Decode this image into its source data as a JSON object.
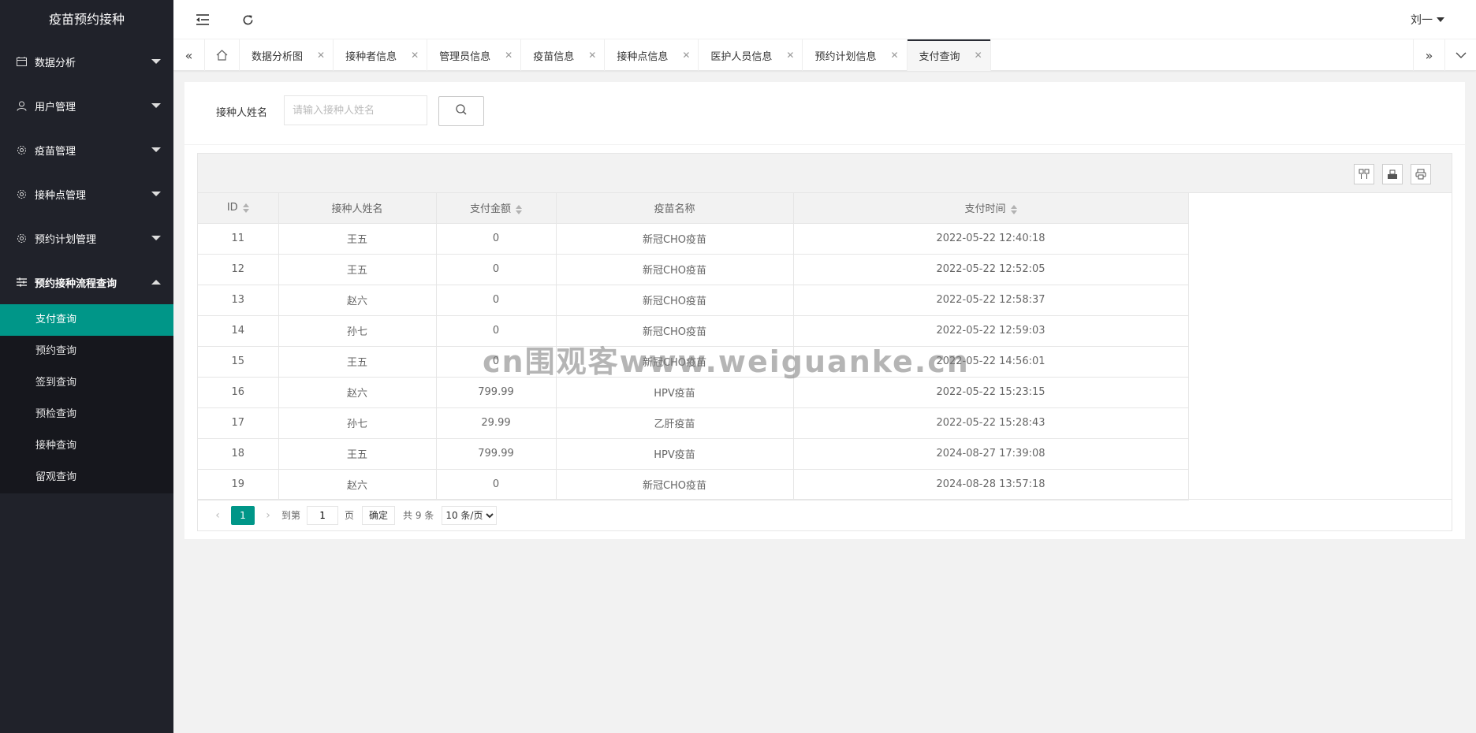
{
  "app": {
    "title": "疫苗预约接种"
  },
  "sidebar": {
    "menus": [
      {
        "label": "数据分析",
        "icon": "calendar-icon"
      },
      {
        "label": "用户管理",
        "icon": "user-icon"
      },
      {
        "label": "疫苗管理",
        "icon": "gear-icon"
      },
      {
        "label": "接种点管理",
        "icon": "gear-icon"
      },
      {
        "label": "预约计划管理",
        "icon": "gear-icon"
      },
      {
        "label": "预约接种流程查询",
        "icon": "sliders-icon"
      }
    ],
    "subitems": [
      "支付查询",
      "预约查询",
      "签到查询",
      "预检查询",
      "接种查询",
      "留观查询"
    ],
    "active_color": "#009688"
  },
  "header": {
    "user": "刘一"
  },
  "tabs": [
    "数据分析图",
    "接种者信息",
    "管理员信息",
    "疫苗信息",
    "接种点信息",
    "医护人员信息",
    "预约计划信息",
    "支付查询"
  ],
  "search": {
    "label": "接种人姓名",
    "placeholder": "请输入接种人姓名"
  },
  "table": {
    "columns": [
      "ID",
      "接种人姓名",
      "支付金额",
      "疫苗名称",
      "支付时间"
    ],
    "rows": [
      [
        "11",
        "王五",
        "0",
        "新冠CHO疫苗",
        "2022-05-22 12:40:18"
      ],
      [
        "12",
        "王五",
        "0",
        "新冠CHO疫苗",
        "2022-05-22 12:52:05"
      ],
      [
        "13",
        "赵六",
        "0",
        "新冠CHO疫苗",
        "2022-05-22 12:58:37"
      ],
      [
        "14",
        "孙七",
        "0",
        "新冠CHO疫苗",
        "2022-05-22 12:59:03"
      ],
      [
        "15",
        "王五",
        "0",
        "新冠CHO疫苗",
        "2022-05-22 14:56:01"
      ],
      [
        "16",
        "赵六",
        "799.99",
        "HPV疫苗",
        "2022-05-22 15:23:15"
      ],
      [
        "17",
        "孙七",
        "29.99",
        "乙肝疫苗",
        "2022-05-22 15:28:43"
      ],
      [
        "18",
        "王五",
        "799.99",
        "HPV疫苗",
        "2024-08-27 17:39:08"
      ],
      [
        "19",
        "赵六",
        "0",
        "新冠CHO疫苗",
        "2024-08-28 13:57:18"
      ]
    ]
  },
  "pager": {
    "current": "1",
    "goto_prefix": "到第",
    "goto_value": "1",
    "goto_suffix": "页",
    "confirm": "确定",
    "total": "共 9 条",
    "page_size": "10 条/页"
  },
  "watermark": "cn围观客www.weiguanke.cn"
}
